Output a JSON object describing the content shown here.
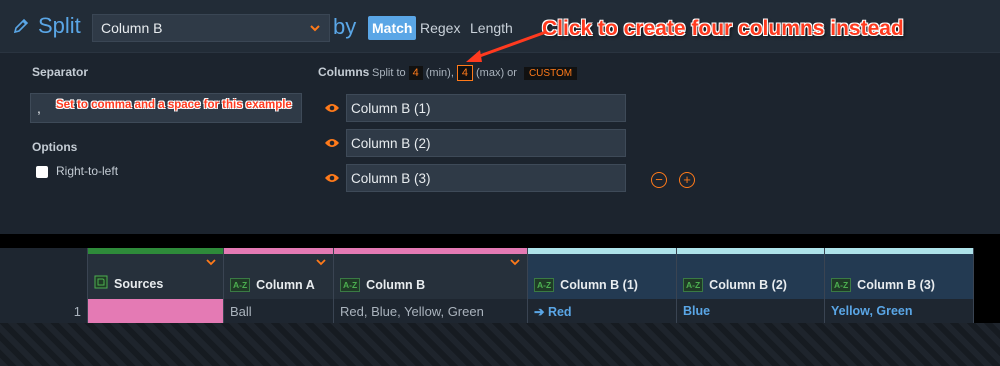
{
  "toolbar": {
    "title": "Split",
    "column_select": "Column B",
    "by_label": "by",
    "modes": [
      "Match",
      "Regex",
      "Length"
    ],
    "active_mode": "Match"
  },
  "annotations": {
    "main": "Click to create four columns instead",
    "separator": "Set to comma and a space for this example"
  },
  "panel": {
    "separator_label": "Separator",
    "separator_value": ",",
    "options_label": "Options",
    "right_to_left_label": "Right-to-left",
    "columns_label": "Columns",
    "split_to": "Split to",
    "min_value": "4",
    "min_label": "(min),",
    "max_value": "4",
    "max_label": "(max) or",
    "custom_label": "CUSTOM",
    "outputs": [
      "Column B (1)",
      "Column B (2)",
      "Column B (3)"
    ]
  },
  "grid": {
    "headers": [
      "Sources",
      "Column A",
      "Column B",
      "Column B (1)",
      "Column B (2)",
      "Column B (3)"
    ],
    "header_bar_colors": [
      "#2e8b3a",
      "#e47ab4",
      "#e47ab4",
      "#aee3ea",
      "#aee3ea",
      "#aee3ea"
    ],
    "rows": [
      {
        "num": "1",
        "column_a": "Ball",
        "column_b": "Red, Blue, Yellow, Green",
        "out1": "Red",
        "out2": "Blue",
        "out3": "Yellow, Green"
      }
    ]
  },
  "colors": {
    "accent": "#5aa6e6",
    "orange": "#ff7a1a",
    "annotation": "#ff3a1f",
    "source_pink": "#e47ab4"
  }
}
